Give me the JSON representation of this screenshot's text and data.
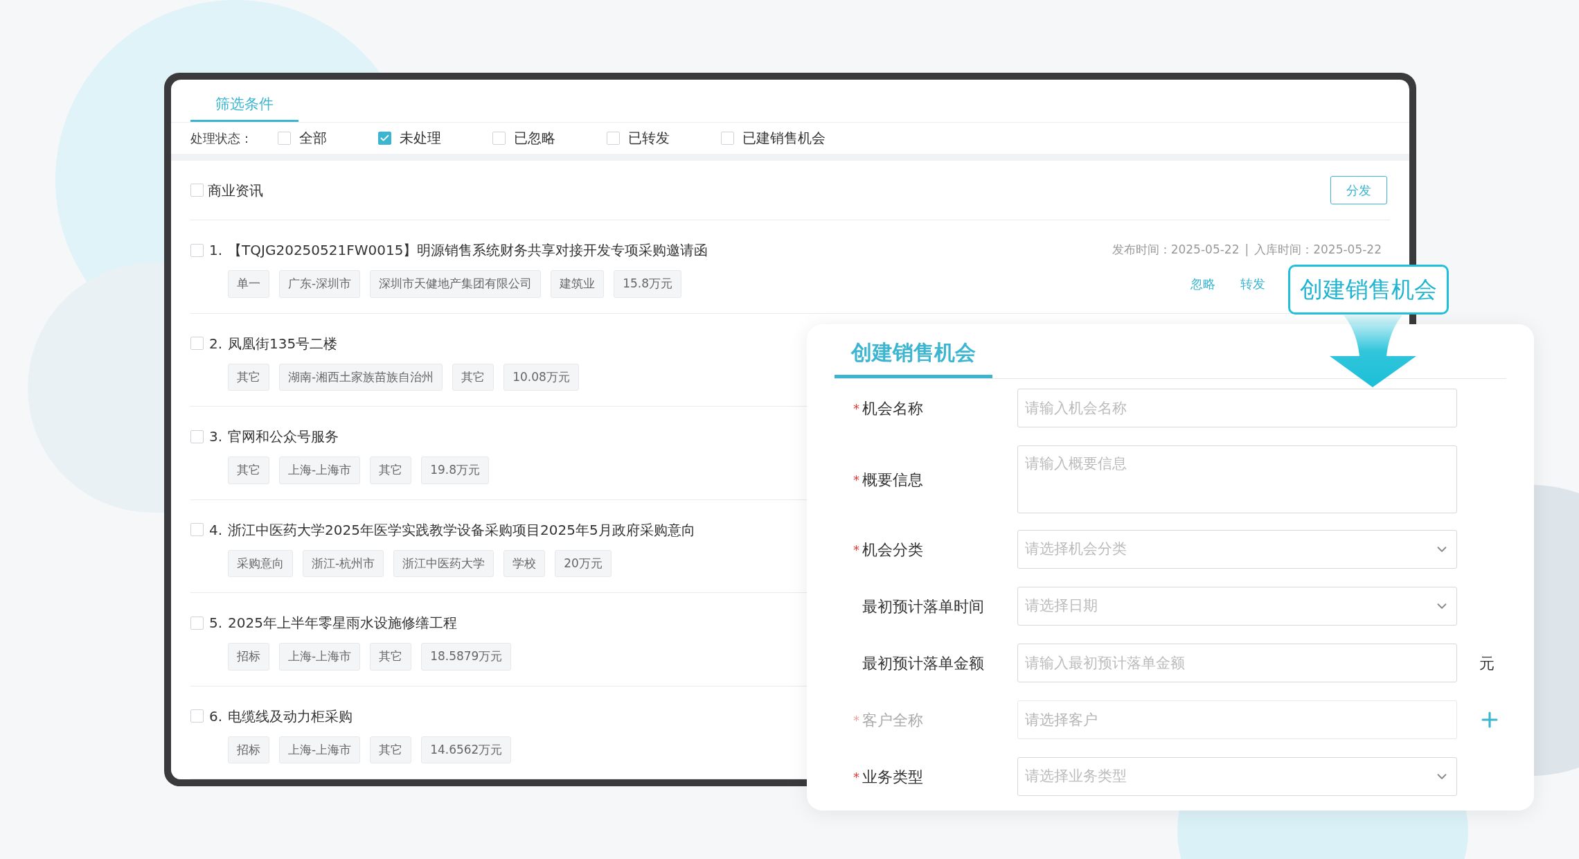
{
  "filter_tabs": [
    {
      "label": "筛选条件",
      "selected": true
    }
  ],
  "status_filter": {
    "label": "处理状态：",
    "options": [
      {
        "label": "全部",
        "checked": false
      },
      {
        "label": "未处理",
        "checked": true
      },
      {
        "label": "已忽略",
        "checked": false
      },
      {
        "label": "已转发",
        "checked": false
      },
      {
        "label": "已建销售机会",
        "checked": false
      }
    ]
  },
  "list": {
    "header": {
      "label": "商业资讯",
      "checked": false
    },
    "distribute_button": "分发",
    "rows": [
      {
        "index": "1.",
        "title": "【TQJG20250521FW0015】明源销售系统财务共享对接开发专项采购邀请函",
        "checked": false,
        "tags": [
          "单一",
          "广东-深圳市",
          "深圳市天健地产集团有限公司",
          "建筑业",
          "15.8万元"
        ],
        "published": "发布时间：2025-05-22",
        "separator": "|",
        "stored": "入库时间：2025-05-22",
        "actions": [
          "忽略",
          "转发"
        ]
      },
      {
        "index": "2.",
        "title": "凤凰街135号二楼",
        "checked": false,
        "tags": [
          "其它",
          "湖南-湘西土家族苗族自治州",
          "其它",
          "10.08万元"
        ]
      },
      {
        "index": "3.",
        "title": "官网和公众号服务",
        "checked": false,
        "tags": [
          "其它",
          "上海-上海市",
          "其它",
          "19.8万元"
        ]
      },
      {
        "index": "4.",
        "title": "浙江中医药大学2025年医学实践教学设备采购项目2025年5月政府采购意向",
        "checked": false,
        "tags": [
          "采购意向",
          "浙江-杭州市",
          "浙江中医药大学",
          "学校",
          "20万元"
        ]
      },
      {
        "index": "5.",
        "title": "2025年上半年零星雨水设施修缮工程",
        "checked": false,
        "tags": [
          "招标",
          "上海-上海市",
          "其它",
          "18.5879万元"
        ]
      },
      {
        "index": "6.",
        "title": "电缆线及动力柜采购",
        "checked": false,
        "tags": [
          "招标",
          "上海-上海市",
          "其它",
          "14.6562万元"
        ]
      }
    ]
  },
  "callout": "创建销售机会",
  "form": {
    "required_mark": "*",
    "tabs": [
      {
        "label": "创建销售机会",
        "selected": true
      }
    ],
    "fields": [
      {
        "kind": "input",
        "label": "机会名称",
        "required": true,
        "disabled": false,
        "placeholder": "请输入机会名称"
      },
      {
        "kind": "textarea",
        "label": "概要信息",
        "required": true,
        "disabled": false,
        "placeholder": "请输入概要信息"
      },
      {
        "kind": "select",
        "label": "机会分类",
        "required": true,
        "disabled": false,
        "placeholder": "请选择机会分类"
      },
      {
        "kind": "select",
        "label": "最初预计落单时间",
        "required": false,
        "disabled": false,
        "placeholder": "请选择日期"
      },
      {
        "kind": "input",
        "label": "最初预计落单金额",
        "required": false,
        "disabled": false,
        "placeholder": "请输入最初预计落单金额",
        "suffix": "元"
      },
      {
        "kind": "add",
        "label": "客户全称",
        "required": true,
        "disabled": true,
        "placeholder": "请选择客户"
      },
      {
        "kind": "select",
        "label": "业务类型",
        "required": true,
        "disabled": false,
        "placeholder": "请选择业务类型"
      }
    ]
  }
}
